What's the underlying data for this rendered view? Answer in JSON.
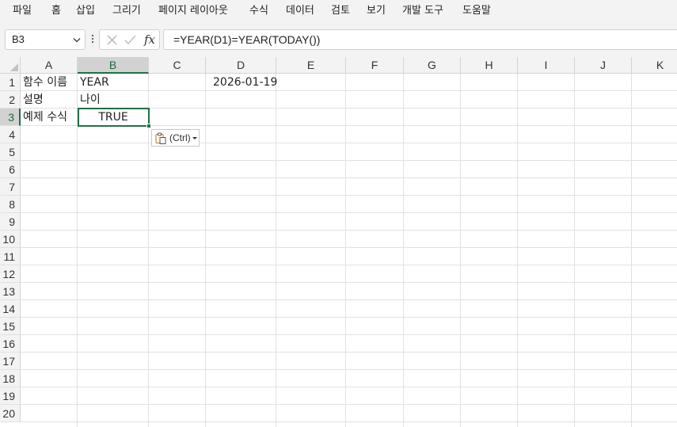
{
  "menu": [
    "파일",
    "홈",
    "삽입",
    "그리기",
    "페이지 레이아웃",
    "수식",
    "데이터",
    "검토",
    "보기",
    "개발 도구",
    "도움말"
  ],
  "formula_bar": {
    "name_box": "B3",
    "fx_label": "fx",
    "formula": "=YEAR(D1)=YEAR(TODAY())"
  },
  "sheet": {
    "columns": [
      "A",
      "B",
      "C",
      "D",
      "E",
      "F",
      "G",
      "H",
      "I",
      "J",
      "K"
    ],
    "rows": [
      "1",
      "2",
      "3",
      "4",
      "5",
      "6",
      "7",
      "8",
      "9",
      "10",
      "11",
      "12",
      "13",
      "14",
      "15",
      "16",
      "17",
      "18",
      "19",
      "20"
    ],
    "selected_cell": "B3",
    "cells": {
      "A1": "함수 이름",
      "B1": "YEAR",
      "D1": "2026-01-19",
      "A2": "설명",
      "B2": "나이",
      "A3": "예제 수식",
      "B3": "TRUE"
    }
  },
  "paste_options": {
    "label": "(Ctrl)"
  },
  "colors": {
    "accent": "#1e7145",
    "header_bg": "#f3f3f3",
    "gridline": "#e1e1e1"
  }
}
